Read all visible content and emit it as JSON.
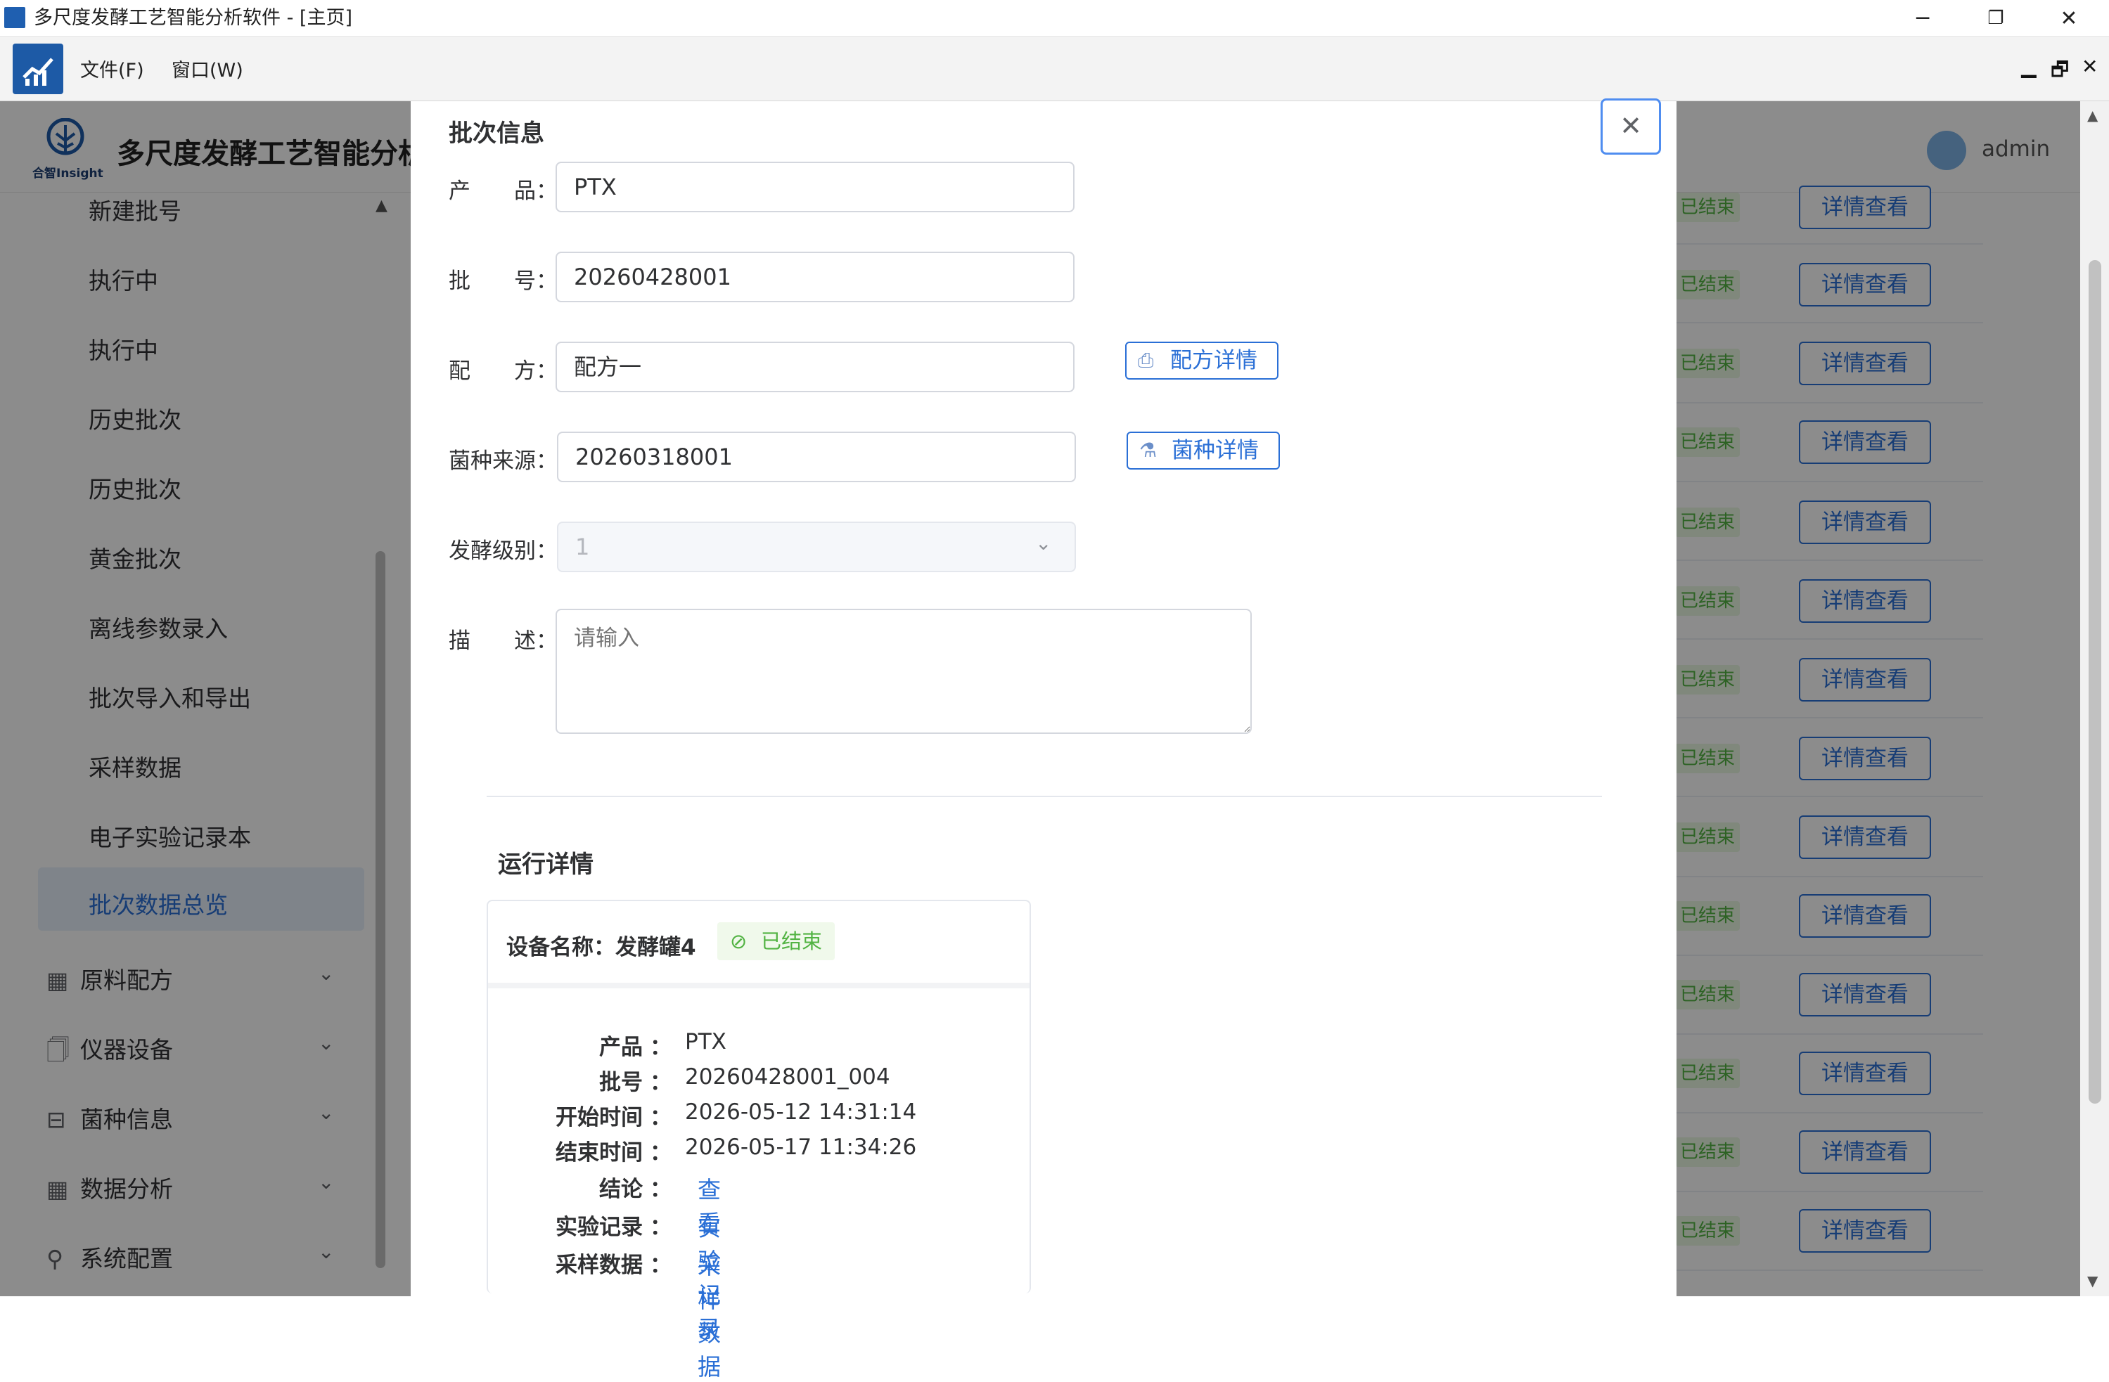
{
  "window": {
    "title": "多尺度发酵工艺智能分析软件 - [主页]",
    "controls": {
      "minimize": "─",
      "restore": "❐",
      "close": "✕"
    }
  },
  "menu": {
    "items": [
      "文件(F)",
      "窗口(W)"
    ],
    "mdi_controls": {
      "minimize": "▁",
      "restore": "🗗",
      "close": "✕"
    }
  },
  "app_header": {
    "logo_text": "合智Insight",
    "title": "多尺度发酵工艺智能分析",
    "user": "admin"
  },
  "sidebar": {
    "sub_items": [
      "新建批号",
      "执行中",
      "执行中",
      "历史批次",
      "历史批次",
      "黄金批次",
      "离线参数录入",
      "批次导入和导出",
      "采样数据",
      "电子实验记录本",
      "批次数据总览"
    ],
    "active_item": "批次数据总览",
    "groups": [
      {
        "label": "原料配方",
        "icon": "▦"
      },
      {
        "label": "仪器设备",
        "icon": "🗍"
      },
      {
        "label": "菌种信息",
        "icon": "⊟"
      },
      {
        "label": "数据分析",
        "icon": "▦"
      },
      {
        "label": "系统配置",
        "icon": "⚲"
      }
    ]
  },
  "background_table": {
    "status_label": "已结束",
    "action_label": "详情查看",
    "row_count": 14
  },
  "modal": {
    "section_title": "批次信息",
    "fields": {
      "product": {
        "label": "产　　品：",
        "value": "PTX"
      },
      "batch_no": {
        "label": "批　　号：",
        "value": "20260428001"
      },
      "recipe": {
        "label": "配　　方：",
        "value": "配方一",
        "button": "配方详情"
      },
      "strain_source": {
        "label": "菌种来源：",
        "value": "20260318001",
        "button": "菌种详情"
      },
      "ferment_level": {
        "label": "发酵级别：",
        "value": "1"
      },
      "description": {
        "label": "描　　述：",
        "placeholder": "请输入"
      }
    },
    "run_section_title": "运行详情",
    "run_card": {
      "device_label": "设备名称：",
      "device_name": "发酵罐4",
      "status": "已结束",
      "rows": [
        {
          "label": "产品",
          "value": "PTX"
        },
        {
          "label": "批号",
          "value": "20260428001_004"
        },
        {
          "label": "开始时间",
          "value": "2026-05-12 14:31:14"
        },
        {
          "label": "结束时间",
          "value": "2026-05-17 11:34:26"
        }
      ],
      "link_rows": [
        {
          "label": "结论",
          "link": "查看"
        },
        {
          "label": "实验记录",
          "link": "实验记录"
        },
        {
          "label": "采样数据",
          "link": "采样数据"
        }
      ],
      "colon": "："
    },
    "close": "✕"
  },
  "colors": {
    "primary": "#2a6fd6",
    "success": "#52b343",
    "mask": "rgba(0,0,0,0.45)"
  }
}
